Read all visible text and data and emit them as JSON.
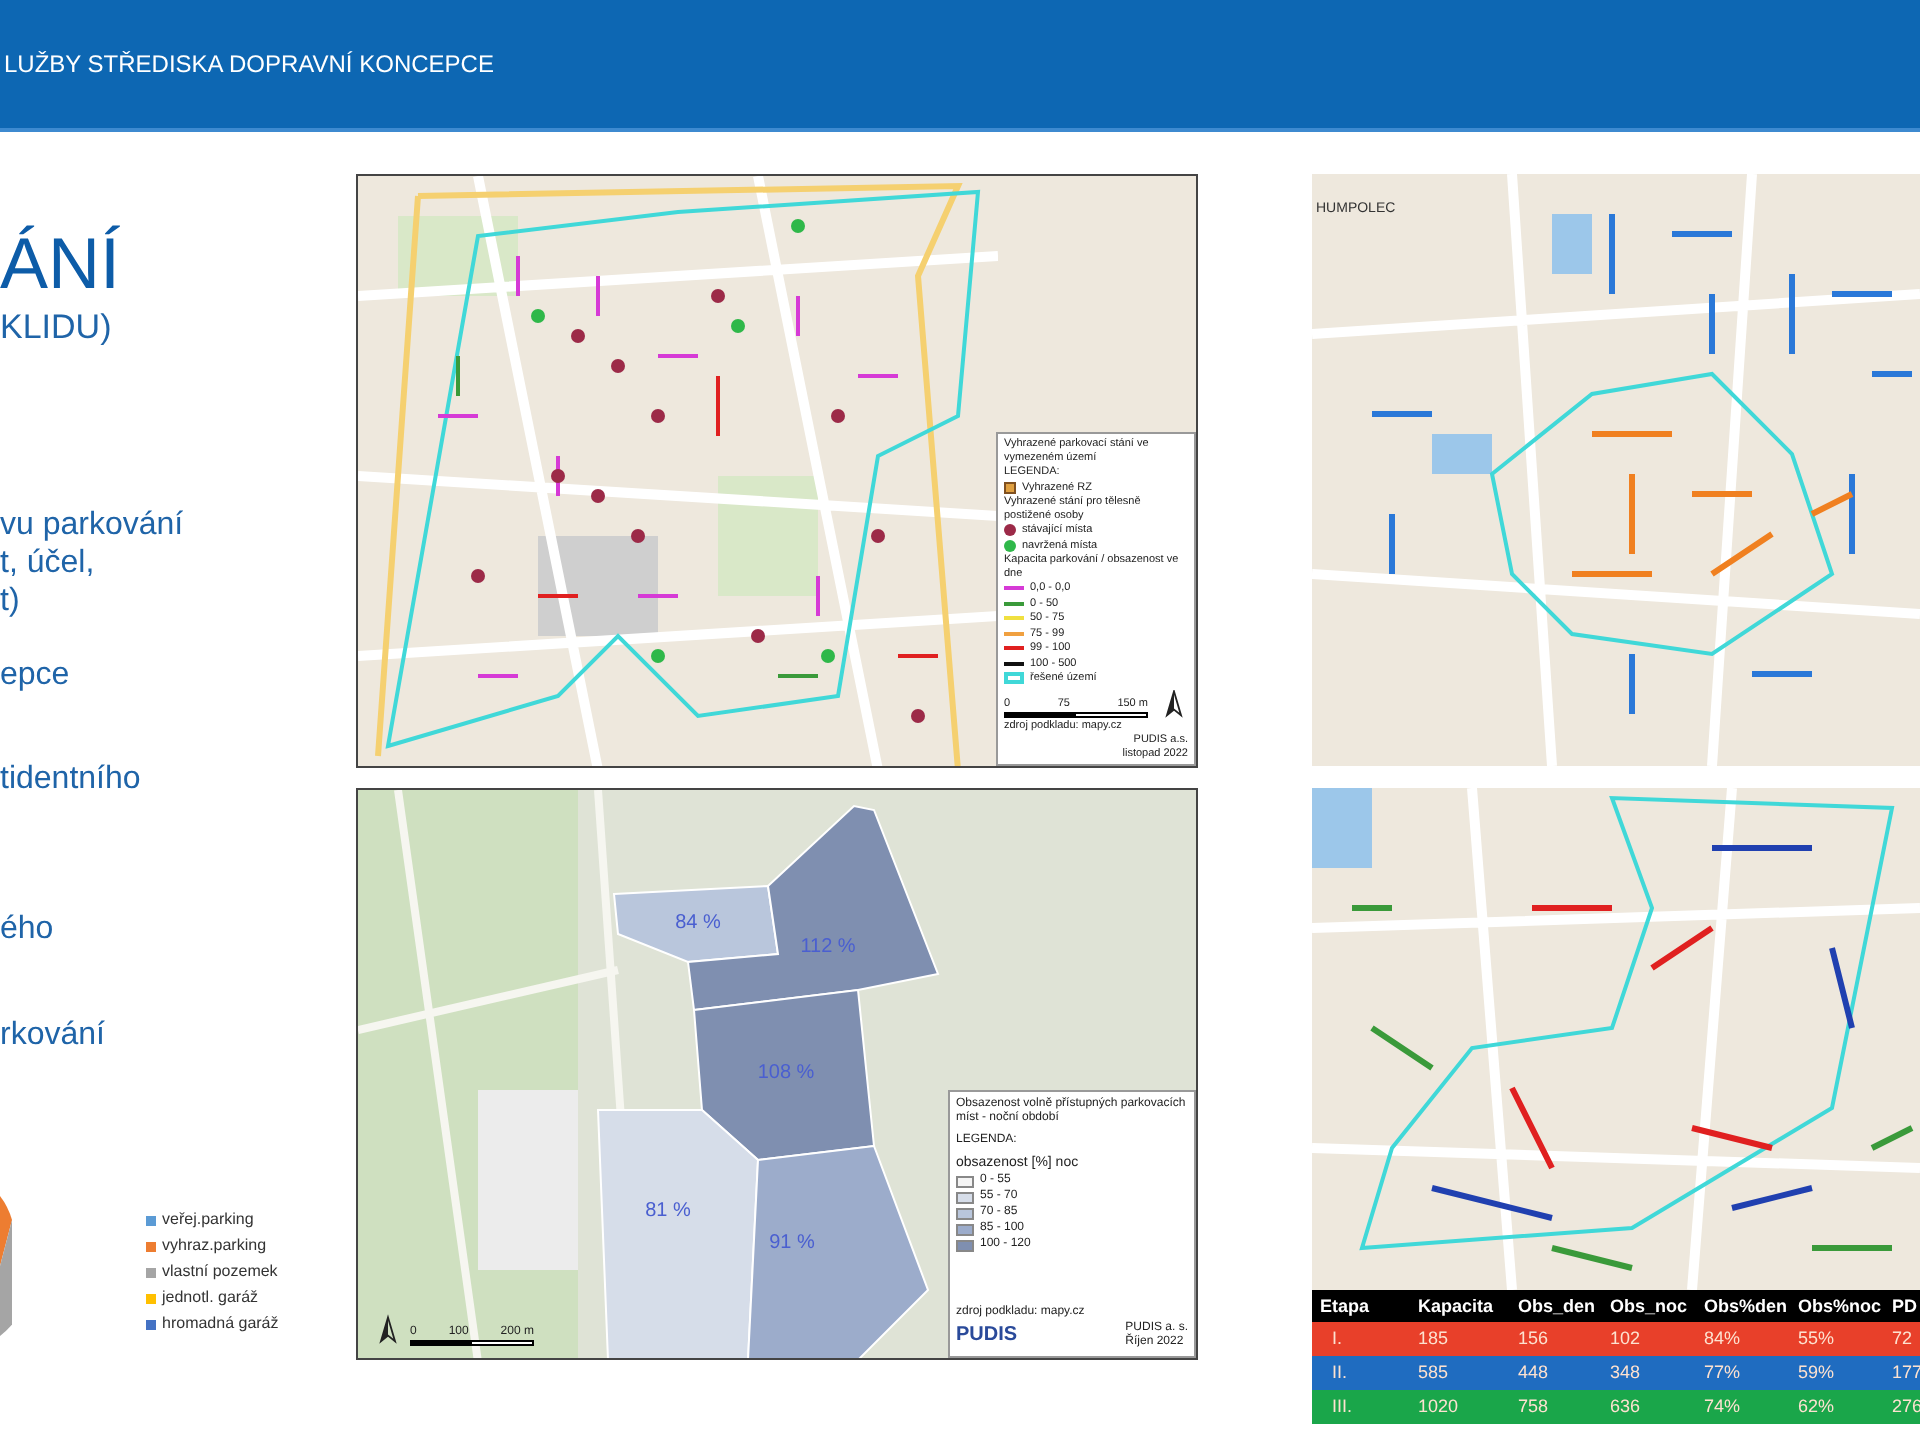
{
  "header": {
    "title": "LUŽBY STŘEDISKA DOPRAVNÍ KONCEPCE"
  },
  "left_panel": {
    "title": "ÁNÍ",
    "subtitle": "KLIDU)",
    "bullets": [
      {
        "text": "vu parkování\nt, účel,\nt)"
      },
      {
        "text": "epce"
      },
      {
        "text": "tidentního"
      },
      {
        "text": "ého"
      },
      {
        "text": "rkování"
      }
    ]
  },
  "pie_legend": [
    {
      "label": "veřej.parking",
      "color": "#5b9bd5"
    },
    {
      "label": "vyhraz.parking",
      "color": "#ed7d31"
    },
    {
      "label": "vlastní pozemek",
      "color": "#a5a5a5"
    },
    {
      "label": "jednotl. garáž",
      "color": "#ffc000"
    },
    {
      "label": "hromadná garáž",
      "color": "#4472c4"
    }
  ],
  "map_reserved": {
    "legend_title": "Vyhrazené parkovací stání ve vymezeném území",
    "legend_heading": "LEGENDA:",
    "items": [
      {
        "kind": "square",
        "label": "Vyhrazené RZ",
        "color": "#e0a040"
      },
      {
        "kind": "heading",
        "label": "Vyhrazené stání pro tělesně postižené osoby"
      },
      {
        "kind": "dot",
        "label": "stávající místa",
        "color": "#9c2a48"
      },
      {
        "kind": "dot",
        "label": "navržená místa",
        "color": "#2fb84a"
      },
      {
        "kind": "heading",
        "label": "Kapacita parkování / obsazenost ve dne"
      },
      {
        "kind": "line",
        "label": "0,0 - 0,0",
        "color": "#d63ad6"
      },
      {
        "kind": "line",
        "label": "0 - 50",
        "color": "#3a9a3a"
      },
      {
        "kind": "line",
        "label": "50 - 75",
        "color": "#f0e040"
      },
      {
        "kind": "line",
        "label": "75 - 99",
        "color": "#f0a040"
      },
      {
        "kind": "line",
        "label": "99 - 100",
        "color": "#e02020"
      },
      {
        "kind": "line",
        "label": "100 - 500",
        "color": "#111111"
      },
      {
        "kind": "outline",
        "label": "řešené území",
        "color": "#40d8d8"
      }
    ],
    "scale": [
      "0",
      "75",
      "150 m"
    ],
    "source": "zdroj podkladu: mapy.cz",
    "company": "PUDIS a.s.",
    "date": "listopad 2022"
  },
  "map_occupancy": {
    "zones": [
      {
        "label": "84 %",
        "color": "#b9c6dc"
      },
      {
        "label": "112 %",
        "color": "#7f8fb0"
      },
      {
        "label": "108 %",
        "color": "#7f8fb0"
      },
      {
        "label": "81 %",
        "color": "#d6dde9"
      },
      {
        "label": "91 %",
        "color": "#9caccb"
      }
    ],
    "legend_title": "Obsazenost volně přístupných parkovacích míst - noční období",
    "legend_heading": "LEGENDA:",
    "legend_subtitle": "obsazenost [%] noc",
    "classes": [
      {
        "label": "0 - 55",
        "color": "#f4f4f4"
      },
      {
        "label": "55 - 70",
        "color": "#d6dde9"
      },
      {
        "label": "70 - 85",
        "color": "#b9c6dc"
      },
      {
        "label": "85 - 100",
        "color": "#9caccb"
      },
      {
        "label": "100 - 120",
        "color": "#7f8fb0"
      }
    ],
    "source": "zdroj podkladu: mapy.cz",
    "logo": "PUDIS",
    "company": "PUDIS a. s.",
    "date": "Říjen 2022",
    "scale": [
      "0",
      "100",
      "200 m"
    ]
  },
  "map_town": {
    "place": "HUMPOLEC"
  },
  "table": {
    "columns": [
      "Etapa",
      "Kapacita",
      "Obs_den",
      "Obs_noc",
      "Obs%den",
      "Obs%noc",
      "PD"
    ],
    "rows": [
      {
        "color": "#e8402a",
        "cells": [
          "I.",
          "185",
          "156",
          "102",
          "84%",
          "55%",
          "72"
        ]
      },
      {
        "color": "#1f6cc0",
        "cells": [
          "II.",
          "585",
          "448",
          "348",
          "77%",
          "59%",
          "177"
        ]
      },
      {
        "color": "#1aa64a",
        "cells": [
          "III.",
          "1020",
          "758",
          "636",
          "74%",
          "62%",
          "276"
        ]
      }
    ]
  }
}
